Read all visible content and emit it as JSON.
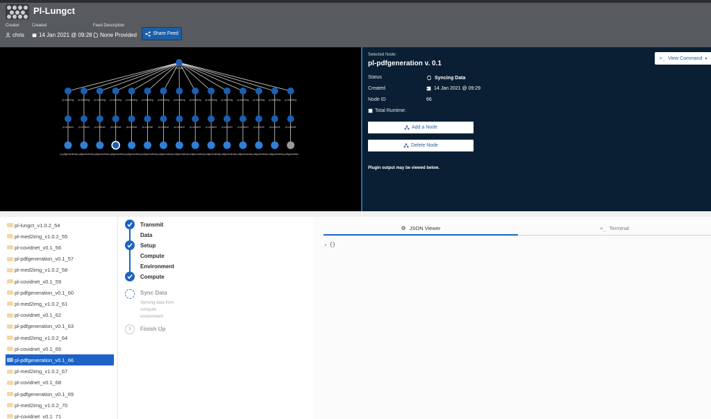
{
  "header": {
    "title": "Pl-Lungct",
    "meta": [
      {
        "label": "Creator",
        "value": "chris",
        "icon": "user-icon"
      },
      {
        "label": "Created",
        "value": "14 Jan 2021 @ 09:28",
        "icon": "calendar-icon"
      },
      {
        "label": "Feed Description",
        "value": "None Provided",
        "icon": "document-icon"
      }
    ],
    "share_label": "Share Feed"
  },
  "graph": {
    "root_label": "pl-lungct",
    "level1_label": "pl-med2img",
    "level2_label": "pl-covidnet",
    "level3_label": "pl-pdfgeneration",
    "columns": 15,
    "selected_column": 3,
    "colors": {
      "node": "#1a5fb4",
      "node_light": "#2f7fd6",
      "pending": "#9a9a9a",
      "edge": "#d8d8d8"
    }
  },
  "details": {
    "selected_label": "Selected Node:",
    "title": "pl-pdfgeneration v. 0.1",
    "view_command_label": "View Command",
    "rows": {
      "status_label": "Status",
      "status_value": "Syncing Data",
      "created_label": "Created",
      "created_value": "14 Jan 2021 @ 09:29",
      "node_id_label": "Node ID",
      "node_id_value": "66",
      "runtime_label": "Total Runtime:"
    },
    "add_node_label": "Add a Node",
    "delete_node_label": "Delete Node",
    "plugin_note": "Plugin output may be viewed below."
  },
  "file_list": [
    "pl-lungct_v1.0.2_54",
    "pl-med2img_v1.0.2_55",
    "pl-covidnet_v0.1_56",
    "pl-pdfgeneration_v0.1_57",
    "pl-med2img_v1.0.2_58",
    "pl-covidnet_v0.1_59",
    "pl-pdfgeneration_v0.1_60",
    "pl-med2img_v1.0.2_61",
    "pl-covidnet_v0.1_62",
    "pl-pdfgeneration_v0.1_63",
    "pl-med2img_v1.0.2_64",
    "pl-covidnet_v0.1_65",
    "pl-pdfgeneration_v0.1_66",
    "pl-med2img_v1.0.2_67",
    "pl-covidnet_v0.1_68",
    "pl-pdfgeneration_v0.1_69",
    "pl-med2img_v1.0.2_70",
    "pl-covidnet_v0.1_71"
  ],
  "selected_file_index": 12,
  "steps": {
    "transmit_1": "Transmit",
    "transmit_2": "Data",
    "setup_1": "Setup",
    "setup_2": "Compute",
    "setup_3": "Environment",
    "compute": "Compute",
    "sync": "Sync Data",
    "sync_desc_1": "Syncing data from",
    "sync_desc_2": "compute",
    "sync_desc_3": "environment",
    "finish": "Finish Up",
    "finish_number": "5"
  },
  "viewer": {
    "tab_json": "JSON Viewer",
    "tab_terminal": "Terminal",
    "json_content": "{}"
  }
}
